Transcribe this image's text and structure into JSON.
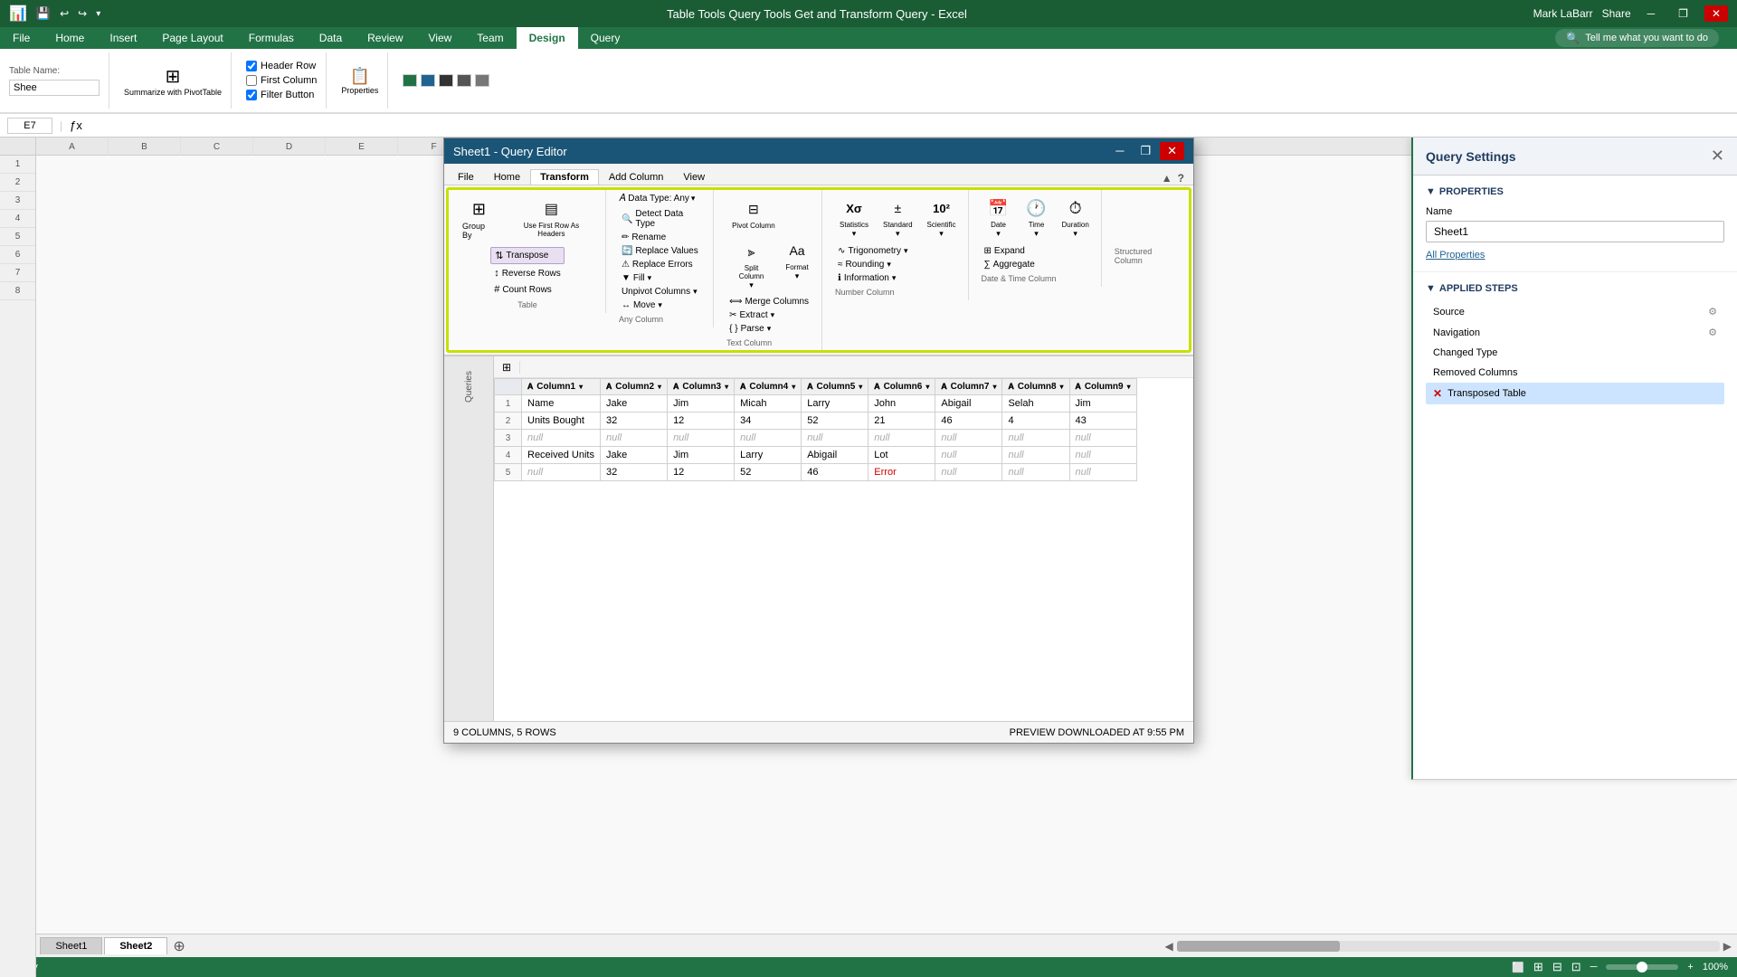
{
  "window": {
    "title": "Table Tools  Query Tools  Get and Transform Query - Excel",
    "user": "Mark LaBarr",
    "share": "Share"
  },
  "excel": {
    "tabs": [
      "File",
      "Home",
      "Insert",
      "Page Layout",
      "Formulas",
      "Data",
      "Review",
      "View",
      "Team",
      "Design",
      "Query"
    ],
    "active_tab": "Design",
    "table_name_label": "Table Name:",
    "summarize_btn": "Summarize with PivotTable",
    "properties_btn": "Properties",
    "checkboxes": [
      "Header Row",
      "First Column",
      "Filter Button"
    ],
    "formula_bar": {
      "cell": "E7",
      "value": ""
    },
    "tell_me": "Tell me what you want to do",
    "sheet_tabs": [
      "Sheet1",
      "Sheet2"
    ],
    "active_sheet": "Sheet2",
    "status": "Ready",
    "zoom": "100%"
  },
  "query_editor": {
    "title": "Sheet1 - Query Editor",
    "ribbon_tabs": [
      "File",
      "Home",
      "Transform",
      "Add Column",
      "View"
    ],
    "active_tab": "Transform",
    "toolbar": {
      "groups": {
        "table": {
          "label": "Table",
          "buttons": [
            {
              "label": "Group By",
              "icon": "⊞"
            },
            {
              "label": "Use First Row As Headers",
              "icon": "▤"
            },
            {
              "label": "Transpose",
              "icon": "⇅"
            },
            {
              "label": "Reverse Rows",
              "icon": "↕"
            },
            {
              "label": "Count Rows",
              "icon": "#"
            }
          ]
        },
        "any_column": {
          "label": "Any Column",
          "buttons": [
            {
              "label": "Data Type: Any",
              "icon": ""
            },
            {
              "label": "Detect Data Type",
              "icon": "🔍"
            },
            {
              "label": "Rename",
              "icon": ""
            },
            {
              "label": "Replace Values",
              "icon": ""
            },
            {
              "label": "Replace Errors",
              "icon": ""
            },
            {
              "label": "Fill",
              "icon": ""
            },
            {
              "label": "Unpivot Columns",
              "icon": ""
            },
            {
              "label": "Move",
              "icon": ""
            }
          ]
        },
        "text_column": {
          "label": "Text Column",
          "buttons": [
            {
              "label": "Split Column",
              "icon": ""
            },
            {
              "label": "Format",
              "icon": ""
            },
            {
              "label": "Merge Columns",
              "icon": ""
            },
            {
              "label": "Extract",
              "icon": ""
            },
            {
              "label": "Parse",
              "icon": ""
            }
          ]
        },
        "number_column": {
          "label": "Number Column",
          "buttons": [
            {
              "label": "Statistics",
              "icon": "X σ"
            },
            {
              "label": "Standard",
              "icon": ""
            },
            {
              "label": "Scientific",
              "icon": "10²"
            },
            {
              "label": "Trigonometry",
              "icon": ""
            },
            {
              "label": "Rounding",
              "icon": ""
            },
            {
              "label": "Information",
              "icon": ""
            }
          ]
        },
        "date_time": {
          "label": "Date & Time Column",
          "buttons": [
            {
              "label": "Date",
              "icon": "📅"
            },
            {
              "label": "Time",
              "icon": "🕐"
            },
            {
              "label": "Duration",
              "icon": "⏱"
            },
            {
              "label": "Expand",
              "icon": ""
            },
            {
              "label": "Aggregate",
              "icon": ""
            }
          ]
        }
      }
    },
    "table": {
      "columns": [
        "Column1",
        "Column2",
        "Column3",
        "Column4",
        "Column5",
        "Column6",
        "Column7",
        "Column8",
        "Column9"
      ],
      "rows": [
        {
          "num": 1,
          "cells": [
            "Name",
            "Jake",
            "Jim",
            "Micah",
            "Larry",
            "John",
            "Abigail",
            "Selah",
            "Jim"
          ]
        },
        {
          "num": 2,
          "cells": [
            "Units Bought",
            "32",
            "12",
            "34",
            "52",
            "21",
            "46",
            "4",
            "43"
          ]
        },
        {
          "num": 3,
          "cells": [
            "null",
            "null",
            "null",
            "null",
            "null",
            "null",
            "null",
            "null",
            "null"
          ]
        },
        {
          "num": 4,
          "cells": [
            "Received Units",
            "Jake",
            "Jim",
            "Larry",
            "Abigail",
            "Lot",
            "null",
            "null",
            "null"
          ]
        },
        {
          "num": 5,
          "cells": [
            "null",
            "32",
            "12",
            "52",
            "46",
            "Error",
            "null",
            "null",
            "null"
          ]
        }
      ]
    },
    "status": {
      "left": "9 COLUMNS, 5 ROWS",
      "right": "PREVIEW DOWNLOADED AT 9:55 PM"
    },
    "sidebar_label": "Queries"
  },
  "query_settings": {
    "title": "Query Settings",
    "properties_label": "PROPERTIES",
    "name_label": "Name",
    "name_value": "Sheet1",
    "all_properties_link": "All Properties",
    "applied_steps_label": "APPLIED STEPS",
    "steps": [
      {
        "name": "Source",
        "has_gear": true,
        "is_active": false,
        "has_error": false
      },
      {
        "name": "Navigation",
        "has_gear": true,
        "is_active": false,
        "has_error": false
      },
      {
        "name": "Changed Type",
        "has_gear": false,
        "is_active": false,
        "has_error": false
      },
      {
        "name": "Removed Columns",
        "has_gear": false,
        "is_active": false,
        "has_error": false
      },
      {
        "name": "Transposed Table",
        "has_gear": false,
        "is_active": true,
        "has_error": true
      }
    ]
  },
  "icons": {
    "minimize": "─",
    "restore": "❐",
    "close": "✕",
    "expand": "▲",
    "help": "?",
    "gear": "⚙",
    "error": "✕",
    "arrow_down": "▾",
    "filter": "▾"
  }
}
